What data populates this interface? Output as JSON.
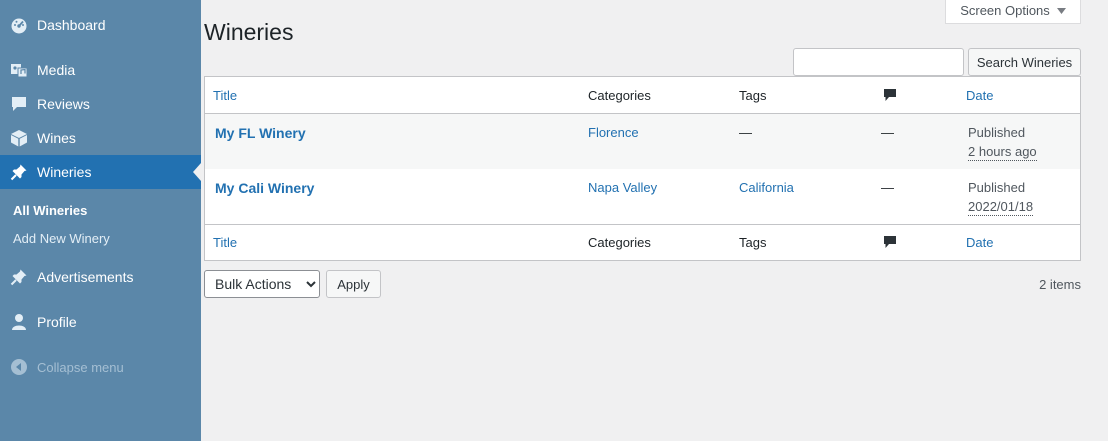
{
  "sidebar": {
    "items": [
      {
        "label": "Dashboard",
        "icon": "dashboard-icon"
      },
      {
        "label": "Media",
        "icon": "media-icon"
      },
      {
        "label": "Reviews",
        "icon": "comment-icon"
      },
      {
        "label": "Wines",
        "icon": "box-icon"
      },
      {
        "label": "Wineries",
        "icon": "pin-icon",
        "current": true
      },
      {
        "label": "Advertisements",
        "icon": "pin-icon"
      },
      {
        "label": "Profile",
        "icon": "user-icon"
      }
    ],
    "submenu": [
      {
        "label": "All Wineries",
        "active": true
      },
      {
        "label": "Add New Winery",
        "active": false
      }
    ],
    "collapse_label": "Collapse menu"
  },
  "header": {
    "screen_options": "Screen Options",
    "title": "Wineries"
  },
  "search": {
    "value": "",
    "placeholder": "",
    "button_label": "Search Wineries"
  },
  "table": {
    "columns": {
      "title": "Title",
      "categories": "Categories",
      "tags": "Tags",
      "comments": "comment-icon",
      "date": "Date"
    },
    "rows": [
      {
        "title": "My FL Winery",
        "category": "Florence",
        "tags": "—",
        "comments": "—",
        "status": "Published",
        "date": "2 hours ago"
      },
      {
        "title": "My Cali Winery",
        "category": "Napa Valley",
        "tags": "California",
        "comments": "—",
        "status": "Published",
        "date": "2022/01/18"
      }
    ]
  },
  "bulk": {
    "selected": "Bulk Actions",
    "apply_label": "Apply"
  },
  "items_count": "2 items",
  "colors": {
    "sidebar": "#5b87a9",
    "current": "#2271b1",
    "link": "#2271b1",
    "background": "#f0f0f1"
  }
}
